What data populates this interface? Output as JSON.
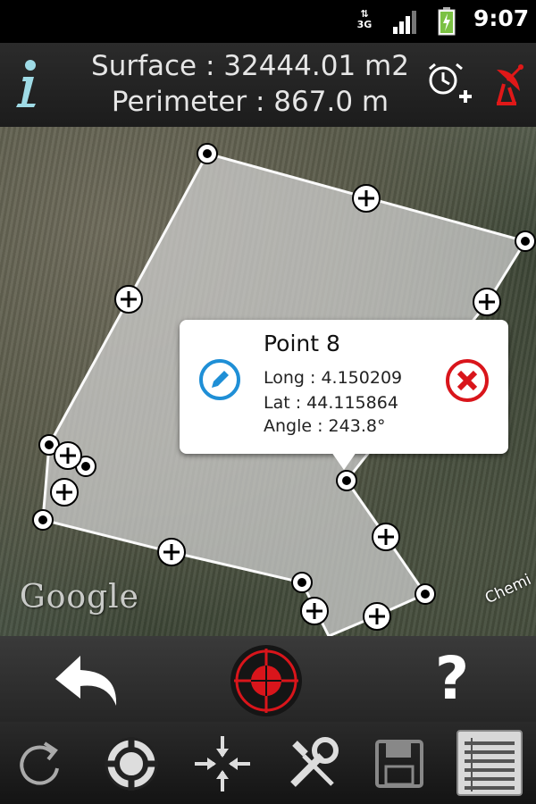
{
  "status_bar": {
    "network": "3G",
    "time": "9:07",
    "icons": [
      "network-3g-icon",
      "signal-icon",
      "battery-charging-icon"
    ]
  },
  "header": {
    "surface": "Surface : 32444.01 m2",
    "perimeter": "Perimeter : 867.0 m",
    "icons": [
      "info-icon",
      "alarm-add-icon",
      "gps-antenna-icon"
    ]
  },
  "map": {
    "attribution": "Google",
    "road_label": "Chemi"
  },
  "popup": {
    "title": "Point 8",
    "long": "Long : 4.150209",
    "lat": "Lat : 44.115864",
    "angle": "Angle : 243.8°",
    "icons": [
      "edit-pencil-icon",
      "delete-x-icon"
    ]
  },
  "toolbar_primary": {
    "help_label": "?",
    "icons": [
      "undo-arrow-icon",
      "crosshair-target-icon"
    ]
  },
  "toolbar_secondary": {
    "icons": [
      "refresh-icon",
      "locate-icon",
      "center-arrows-icon",
      "tools-icon",
      "save-icon",
      "list-icon"
    ]
  },
  "colors": {
    "accent_red": "#d9151b",
    "edit_blue": "#1f8fd6",
    "toolbar_dark": "#262626"
  }
}
